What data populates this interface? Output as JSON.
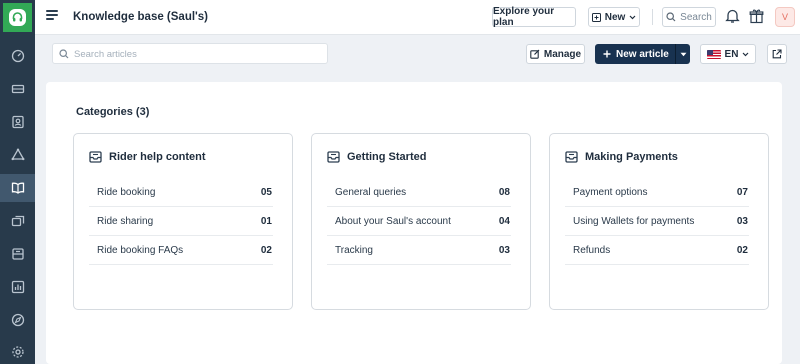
{
  "header": {
    "title": "Knowledge base (Saul's)",
    "explore_label": "Explore your plan",
    "new_label": "New",
    "search_label": "Search",
    "avatar_initial": "V"
  },
  "toolbar": {
    "search_placeholder": "Search articles",
    "manage_label": "Manage",
    "new_article_label": "New article",
    "language": "EN"
  },
  "sidebar": {
    "icons": [
      "dashboard-icon",
      "tickets-icon",
      "contacts-icon",
      "groups-icon",
      "knowledge-base-icon",
      "conversations-icon",
      "archive-icon",
      "reports-icon",
      "explore-icon",
      "settings-icon"
    ],
    "active": "knowledge-base-icon"
  },
  "categories": {
    "heading": "Categories (3)",
    "cards": [
      {
        "title": "Rider help content",
        "items": [
          {
            "label": "Ride booking",
            "count": "05"
          },
          {
            "label": "Ride sharing",
            "count": "01"
          },
          {
            "label": "Ride booking FAQs",
            "count": "02"
          }
        ]
      },
      {
        "title": "Getting Started",
        "items": [
          {
            "label": "General queries",
            "count": "08"
          },
          {
            "label": "About your Saul's account",
            "count": "04"
          },
          {
            "label": "Tracking",
            "count": "03"
          }
        ]
      },
      {
        "title": "Making Payments",
        "items": [
          {
            "label": "Payment options",
            "count": "07"
          },
          {
            "label": "Using Wallets for payments",
            "count": "03"
          },
          {
            "label": "Refunds",
            "count": "02"
          }
        ]
      }
    ]
  },
  "colors": {
    "rail": "#283a4b",
    "brand": "#32a956",
    "primary_button": "#183250"
  }
}
